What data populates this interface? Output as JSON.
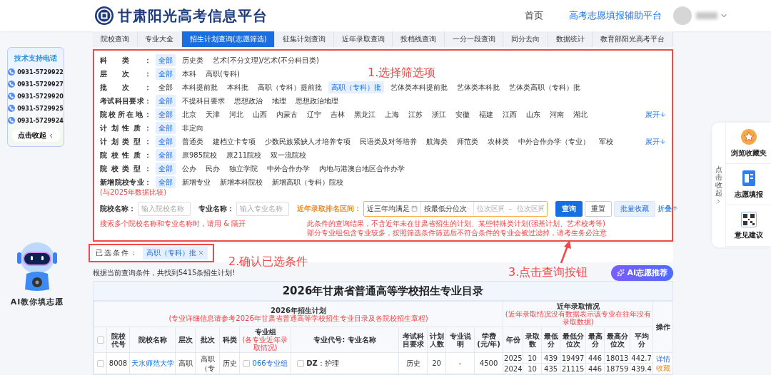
{
  "header": {
    "site_title": "甘肃阳光高考信息平台",
    "nav": [
      {
        "label": "首页",
        "selected": false
      },
      {
        "label": "高考志愿填报辅助平台",
        "selected": true
      }
    ]
  },
  "tabs": [
    {
      "label": "院校查询",
      "selected": false
    },
    {
      "label": "专业大全",
      "selected": false
    },
    {
      "label": "招生计划查询(志愿筛选)",
      "selected": true
    },
    {
      "label": "征集计划查询",
      "selected": false
    },
    {
      "label": "近年录取查询",
      "selected": false
    },
    {
      "label": "投档线查询",
      "selected": false
    },
    {
      "label": "一分一段查询",
      "selected": false
    },
    {
      "label": "同分去向",
      "selected": false
    },
    {
      "label": "数据统计",
      "selected": false
    },
    {
      "label": "教育部阳光高考平台",
      "selected": false
    }
  ],
  "support": {
    "title": "技术支持电话",
    "phones": [
      "0931-5729922",
      "0931-5729927",
      "0931-5729920",
      "0931-5729925",
      "0931-5729924"
    ],
    "collapse": "点击收起"
  },
  "assistant": {
    "caption": "AI教你填志愿"
  },
  "filters": [
    {
      "label": "科类：",
      "options": [
        {
          "label": "全部",
          "selected": true
        },
        {
          "label": "历史类",
          "selected": false
        },
        {
          "label": "艺术(不分文理)/艺术(不分科目类)",
          "selected": false
        }
      ]
    },
    {
      "label": "层次：",
      "options": [
        {
          "label": "全部",
          "selected": true
        },
        {
          "label": "本科",
          "selected": false
        },
        {
          "label": "高职(专科)",
          "selected": false
        }
      ]
    },
    {
      "label": "批次：",
      "options": [
        {
          "label": "全部",
          "selected": false
        },
        {
          "label": "本科提前批",
          "selected": false
        },
        {
          "label": "本科批",
          "selected": false
        },
        {
          "label": "高职（专科）提前批",
          "selected": false
        },
        {
          "label": "高职（专科）批",
          "selected": true
        },
        {
          "label": "艺体类本科提前批",
          "selected": false
        },
        {
          "label": "艺体类本科批",
          "selected": false
        },
        {
          "label": "艺体类高职（专科）批",
          "selected": false
        }
      ]
    },
    {
      "label": "考试科目要求：",
      "options": [
        {
          "label": "全部",
          "selected": true
        },
        {
          "label": "不提科目要求",
          "selected": false
        },
        {
          "label": "思想政治",
          "selected": false
        },
        {
          "label": "地理",
          "selected": false
        },
        {
          "label": "思想政治地理",
          "selected": false
        }
      ]
    },
    {
      "label": "院校所在地：",
      "expand": "展开",
      "options": [
        {
          "label": "全部",
          "selected": true
        },
        {
          "label": "北京",
          "selected": false
        },
        {
          "label": "天津",
          "selected": false
        },
        {
          "label": "河北",
          "selected": false
        },
        {
          "label": "山西",
          "selected": false
        },
        {
          "label": "内蒙古",
          "selected": false
        },
        {
          "label": "辽宁",
          "selected": false
        },
        {
          "label": "吉林",
          "selected": false
        },
        {
          "label": "黑龙江",
          "selected": false
        },
        {
          "label": "上海",
          "selected": false
        },
        {
          "label": "江苏",
          "selected": false
        },
        {
          "label": "浙江",
          "selected": false
        },
        {
          "label": "安徽",
          "selected": false
        },
        {
          "label": "福建",
          "selected": false
        },
        {
          "label": "江西",
          "selected": false
        },
        {
          "label": "山东",
          "selected": false
        },
        {
          "label": "河南",
          "selected": false
        },
        {
          "label": "湖北",
          "selected": false
        }
      ]
    },
    {
      "label": "计划性质：",
      "options": [
        {
          "label": "全部",
          "selected": true
        },
        {
          "label": "非定向",
          "selected": false
        }
      ]
    },
    {
      "label": "计划类型：",
      "expand": "展开",
      "options": [
        {
          "label": "全部",
          "selected": true
        },
        {
          "label": "普通类",
          "selected": false
        },
        {
          "label": "建档立卡专项",
          "selected": false
        },
        {
          "label": "少数民族紧缺人才培养专项",
          "selected": false
        },
        {
          "label": "民语类及对等培养",
          "selected": false
        },
        {
          "label": "航海类",
          "selected": false
        },
        {
          "label": "师范类",
          "selected": false
        },
        {
          "label": "农林类",
          "selected": false
        },
        {
          "label": "中外合作办学（专业）",
          "selected": false
        },
        {
          "label": "军校",
          "selected": false
        }
      ]
    },
    {
      "label": "院校性质：",
      "options": [
        {
          "label": "全部",
          "selected": true
        },
        {
          "label": "原985院校",
          "selected": false
        },
        {
          "label": "原211院校",
          "selected": false
        },
        {
          "label": "双一流院校",
          "selected": false
        }
      ]
    },
    {
      "label": "院校类型：",
      "options": [
        {
          "label": "全部",
          "selected": true
        },
        {
          "label": "公办",
          "selected": false
        },
        {
          "label": "民办",
          "selected": false
        },
        {
          "label": "独立学院",
          "selected": false
        },
        {
          "label": "中外合作办学",
          "selected": false
        },
        {
          "label": "内地与港澳台地区合作办学",
          "selected": false
        }
      ]
    },
    {
      "label": "新增院校专业：",
      "note": "(与2025年数据比较)",
      "options": [
        {
          "label": "全部",
          "selected": true
        },
        {
          "label": "新增专业",
          "selected": false
        },
        {
          "label": "新增本科院校",
          "selected": false
        },
        {
          "label": "新增高职（专科）院校",
          "selected": false
        }
      ]
    }
  ],
  "search": {
    "school_label": "院校名称：",
    "school_placeholder": "输入院校名称",
    "major_label": "专业名称：",
    "major_placeholder": "输入专业名称",
    "rank_label": "近年录取排名区间：",
    "rank_mode": "近三年均满足",
    "rank_basis": "按最低分位次",
    "rank_from_placeholder": "位次区间",
    "rank_sep": "-",
    "rank_to_placeholder": "位次区间",
    "query_button": "查询",
    "reset_button": "重置",
    "batch_button": "批量收藏",
    "fold": "折叠",
    "name_hint": "搜索多个院校名称和专业名称时，请用 & 隔开",
    "notes": [
      "此条件的查询结果，不含近年未在甘肃省招生的计划、某些特殊类计划(强基计划、艺术校考等)",
      "部分专业组包含专业较多，按照筛选条件筛选后不符合条件的专业会被过滤掉，请考生务必注意"
    ]
  },
  "selected_conditions": {
    "label": "已选条件：",
    "chips": [
      "高职（专科）批"
    ]
  },
  "result_text": "根据当前查询条件，共找到5415条招生计划!",
  "ai_button": "AI志愿推荐",
  "annotations": [
    "1.选择筛选项",
    "2.确认已选条件",
    "3.点击查询按钮"
  ],
  "table": {
    "title": "2026年甘肃省普通高等学校招生专业目录",
    "groups": [
      {
        "title": "2026年招生计划",
        "note": "(专业详细信息请参考2026年甘肃省普通高等学校招生专业目录及各院校招生章程)"
      },
      {
        "title": "近年录取情况",
        "note": "(近年录取情况没有数据表示该专业在往年没有录取数据)"
      }
    ],
    "actions_header": "操作",
    "select_all_checked": false,
    "columns": [
      {
        "label": "院校代号"
      },
      {
        "label": "院校名称"
      },
      {
        "label": "层次"
      },
      {
        "label": "批次"
      },
      {
        "label": "科类"
      },
      {
        "label": "专业组",
        "note": "(各专业近年录取情况)"
      },
      {
        "label": "专业代号: 专业名称"
      },
      {
        "label": "考试科目要求"
      },
      {
        "label": "计划人数"
      },
      {
        "label": "专业说明"
      },
      {
        "label": "学费(元/年)"
      },
      {
        "label": "年份"
      },
      {
        "label": "录取数"
      },
      {
        "label": "最低分"
      },
      {
        "label": "最低分位次"
      },
      {
        "label": "最高分"
      },
      {
        "label": "最高分位次"
      },
      {
        "label": "平均分"
      }
    ],
    "rows": [
      {
        "checked": false,
        "school_code": "8008",
        "school_name": "天水师范大学",
        "level": "高职",
        "batch": "高职（专",
        "category": "历史",
        "group": {
          "label": "066专业组",
          "checked": false
        },
        "major": {
          "text": "**DZ**：护理",
          "checked": false
        },
        "exam": "历史",
        "plan": "20",
        "note": "-",
        "fee": "4500",
        "history": [
          [
            "2025",
            "10",
            "439",
            "19497",
            "446",
            "18013",
            "442.7"
          ],
          [
            "2024",
            "10",
            "435",
            "21115",
            "446",
            "18759",
            "439.4"
          ]
        ],
        "actions": [
          {
            "label": "详情",
            "kind": "detail"
          },
          {
            "label": "收藏",
            "kind": "favorite"
          }
        ]
      }
    ]
  },
  "right_panel": {
    "collapse": "点击收起",
    "items": [
      {
        "label": "浏览收藏夹",
        "kind": "favorites"
      },
      {
        "label": "志愿填报",
        "kind": "apply"
      },
      {
        "label": "意见建议",
        "kind": "feedback"
      }
    ]
  }
}
